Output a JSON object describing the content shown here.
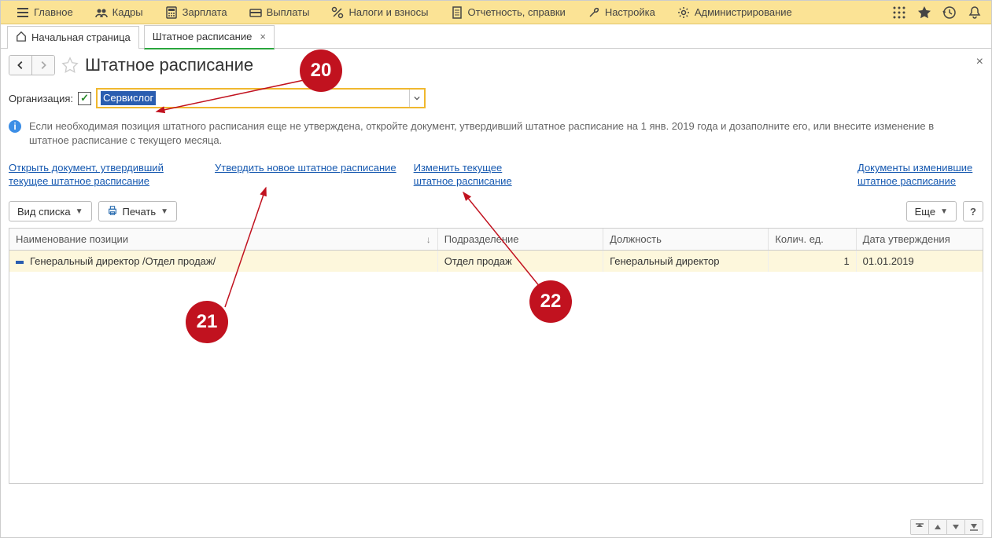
{
  "toolbar": {
    "items": [
      {
        "label": "Главное"
      },
      {
        "label": "Кадры"
      },
      {
        "label": "Зарплата"
      },
      {
        "label": "Выплаты"
      },
      {
        "label": "Налоги и взносы"
      },
      {
        "label": "Отчетность, справки"
      },
      {
        "label": "Настройка"
      },
      {
        "label": "Администрирование"
      }
    ]
  },
  "tabs": {
    "home_label": "Начальная страница",
    "items": [
      {
        "label": "Штатное расписание",
        "active": true
      }
    ]
  },
  "page": {
    "title": "Штатное расписание"
  },
  "org": {
    "label": "Организация:",
    "value": "Сервислог",
    "checked": true
  },
  "info": {
    "text": "Если необходимая позиция штатного расписания еще не утверждена, откройте документ, утвердивший штатное расписание на 1 янв. 2019 года и дозаполните его, или внесите изменение в штатное расписание с текущего месяца."
  },
  "links": {
    "open_doc": "Открыть документ, утвердивший текущее штатное расписание",
    "approve_new": "Утвердить новое штатное расписание",
    "change_current": "Изменить текущее штатное расписание",
    "changed_docs": "Документы изменившие штатное расписание"
  },
  "buttons": {
    "view_mode": "Вид списка",
    "print": "Печать",
    "more": "Еще",
    "help": "?"
  },
  "grid": {
    "columns": {
      "name": "Наименование позиции",
      "dept": "Подразделение",
      "post": "Должность",
      "qty": "Колич. ед.",
      "date": "Дата утверждения"
    },
    "rows": [
      {
        "name": "Генеральный директор /Отдел продаж/",
        "dept": "Отдел продаж",
        "post": "Генеральный директор",
        "qty": "1",
        "date": "01.01.2019"
      }
    ]
  },
  "annotations": {
    "a20": "20",
    "a21": "21",
    "a22": "22"
  }
}
